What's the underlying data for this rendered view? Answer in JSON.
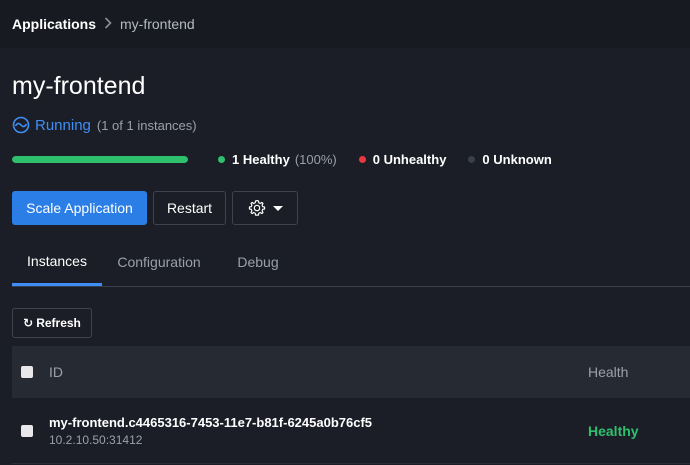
{
  "breadcrumb": {
    "root": "Applications",
    "separator": ">",
    "current": "my-frontend"
  },
  "app": {
    "title": "my-frontend",
    "status": "Running",
    "status_detail": "(1 of 1 instances)",
    "status_icon": "running-gauge-icon"
  },
  "health": {
    "healthy_fraction": 1.0,
    "healthy_label": "1 Healthy",
    "healthy_pct": "(100%)",
    "unhealthy_label": "0 Unhealthy",
    "unknown_label": "0 Unknown",
    "colors": {
      "healthy": "#2fc06d",
      "unhealthy": "#e8393f",
      "unknown": "#3a3f4c"
    }
  },
  "actions": {
    "scale_label": "Scale Application",
    "restart_label": "Restart",
    "settings_icon": "gear-icon",
    "dropdown_icon": "caret-down-icon"
  },
  "tabs": [
    {
      "label": "Instances",
      "active": true
    },
    {
      "label": "Configuration",
      "active": false
    },
    {
      "label": "Debug",
      "active": false
    }
  ],
  "instances": {
    "refresh_label": "Refresh",
    "refresh_icon": "refresh-icon",
    "columns": {
      "id": "ID",
      "health": "Health"
    },
    "rows": [
      {
        "id": "my-frontend.c4465316-7453-11e7-b81f-6245a0b76cf5",
        "address": "10.2.10.50:31412",
        "health": "Healthy"
      }
    ]
  },
  "colors": {
    "accent": "#3f8ef5",
    "primary_button": "#2b7ee6",
    "background": "#1b1e26"
  }
}
